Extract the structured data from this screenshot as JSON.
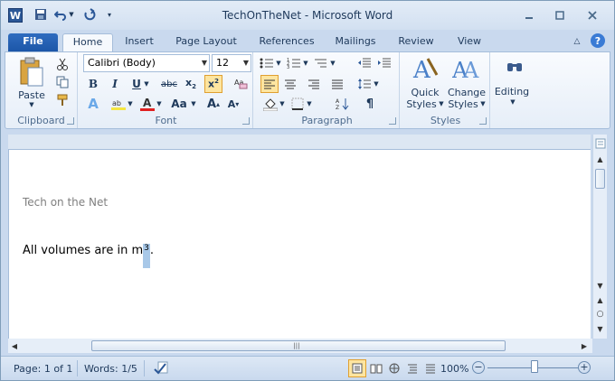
{
  "window": {
    "title": "TechOnTheNet - Microsoft Word"
  },
  "tabs": {
    "file": "File",
    "home": "Home",
    "insert": "Insert",
    "page_layout": "Page Layout",
    "references": "References",
    "mailings": "Mailings",
    "review": "Review",
    "view": "View"
  },
  "font": {
    "name": "Calibri (Body)",
    "size": "12"
  },
  "clipboard": {
    "paste": "Paste",
    "label": "Clipboard"
  },
  "font_group": {
    "label": "Font"
  },
  "paragraph_group": {
    "label": "Paragraph"
  },
  "styles_group": {
    "quick_l1": "Quick",
    "quick_l2": "Styles",
    "change_l1": "Change",
    "change_l2": "Styles",
    "label": "Styles"
  },
  "editing": {
    "label": "Editing"
  },
  "document": {
    "header": "Tech on the Net",
    "body_text": "All volumes are in m",
    "superscript": "3",
    "trailing": "."
  },
  "status": {
    "page": "Page: 1 of 1",
    "words": "Words: 1/5",
    "zoom": "100%"
  },
  "colors": {
    "accent": "#2b5797",
    "highlight": "#a8c8e8",
    "font_color": "#e02020",
    "highlight_color": "#f5e642"
  }
}
